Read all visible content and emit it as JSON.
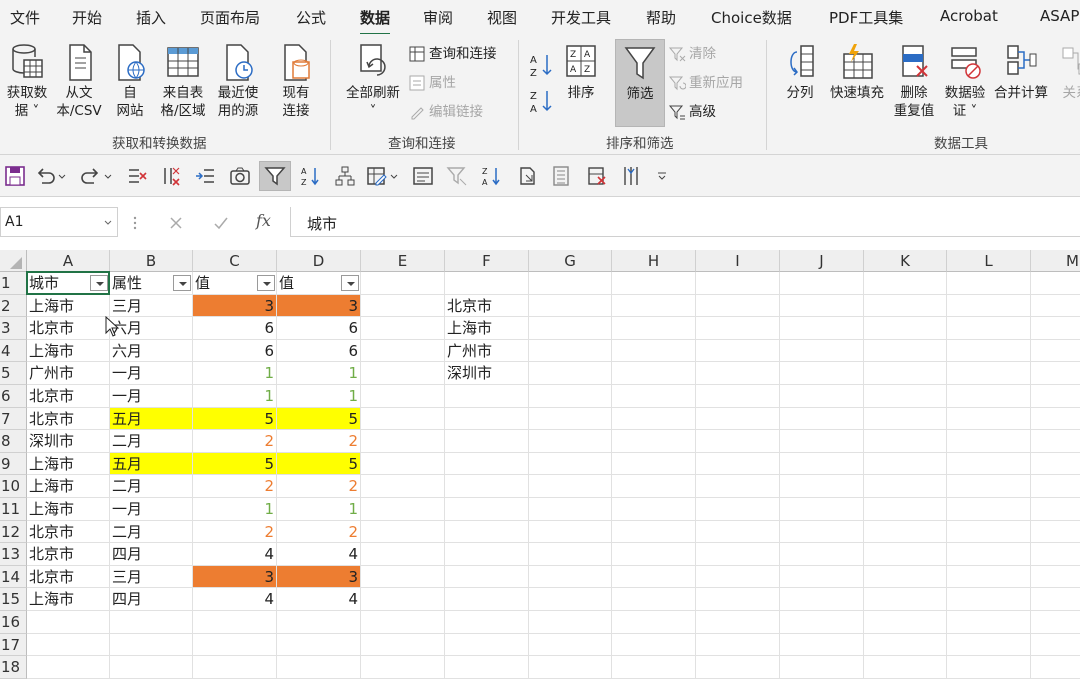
{
  "menu": [
    "文件",
    "开始",
    "插入",
    "页面布局",
    "公式",
    "数据",
    "审阅",
    "视图",
    "开发工具",
    "帮助",
    "Choice数据",
    "PDF工具集",
    "Acrobat",
    "ASAP"
  ],
  "menu_active": "数据",
  "ribbon": {
    "get_data": "获取数\n据 ˅",
    "from_text": "从文\n本/CSV",
    "from_web": "自\n网站",
    "from_table": "来自表\n格/区域",
    "recent_sources": "最近使\n用的源",
    "existing_conn": "现有\n连接",
    "group_get": "获取和转换数据",
    "refresh_all": "全部刷新\n˅",
    "queries_conn": "查询和连接",
    "properties": "属性",
    "edit_links": "编辑链接",
    "group_queries": "查询和连接",
    "sort": "排序",
    "filter": "筛选",
    "clear": "清除",
    "reapply": "重新应用",
    "advanced": "高级",
    "group_sort": "排序和筛选",
    "text_to_cols": "分列",
    "flash_fill": "快速填充",
    "remove_dup": "删除\n重复值",
    "data_validation": "数据验\n证 ˅",
    "consolidate": "合并计算",
    "relations": "关系",
    "group_tools": "数据工具"
  },
  "formula_bar": {
    "name_box": "A1",
    "fx": "fx",
    "value": "城市"
  },
  "columns": [
    "A",
    "B",
    "C",
    "D",
    "E",
    "F",
    "G",
    "H",
    "I",
    "J",
    "K",
    "L",
    "M"
  ],
  "rows": [
    "1",
    "2",
    "3",
    "4",
    "5",
    "6",
    "7",
    "8",
    "9",
    "10",
    "11",
    "12",
    "13",
    "14",
    "15",
    "16",
    "17",
    "18"
  ],
  "headers": [
    "城市",
    "属性",
    "值",
    "值"
  ],
  "table": [
    {
      "city": "上海市",
      "attr": "三月",
      "c": "3",
      "d": "3",
      "hl": "orange"
    },
    {
      "city": "北京市",
      "attr": "六月",
      "c": "6",
      "d": "6",
      "hl": ""
    },
    {
      "city": "上海市",
      "attr": "六月",
      "c": "6",
      "d": "6",
      "hl": ""
    },
    {
      "city": "广州市",
      "attr": "一月",
      "c": "1",
      "d": "1",
      "hl": ""
    },
    {
      "city": "北京市",
      "attr": "一月",
      "c": "1",
      "d": "1",
      "hl": ""
    },
    {
      "city": "北京市",
      "attr": "五月",
      "c": "5",
      "d": "5",
      "hl": "yellow"
    },
    {
      "city": "深圳市",
      "attr": "二月",
      "c": "2",
      "d": "2",
      "hl": ""
    },
    {
      "city": "上海市",
      "attr": "五月",
      "c": "5",
      "d": "5",
      "hl": "yellow"
    },
    {
      "city": "上海市",
      "attr": "二月",
      "c": "2",
      "d": "2",
      "hl": ""
    },
    {
      "city": "上海市",
      "attr": "一月",
      "c": "1",
      "d": "1",
      "hl": ""
    },
    {
      "city": "北京市",
      "attr": "二月",
      "c": "2",
      "d": "2",
      "hl": ""
    },
    {
      "city": "北京市",
      "attr": "四月",
      "c": "4",
      "d": "4",
      "hl": ""
    },
    {
      "city": "北京市",
      "attr": "三月",
      "c": "3",
      "d": "3",
      "hl": "orange"
    },
    {
      "city": "上海市",
      "attr": "四月",
      "c": "4",
      "d": "4",
      "hl": ""
    }
  ],
  "f_list": [
    "北京市",
    "上海市",
    "广州市",
    "深圳市"
  ],
  "colors": {
    "accent": "#217346",
    "orange": "#ed7d31",
    "yellow": "#ffff00",
    "val1": "#70ad47",
    "val2": "#ed7d31"
  }
}
